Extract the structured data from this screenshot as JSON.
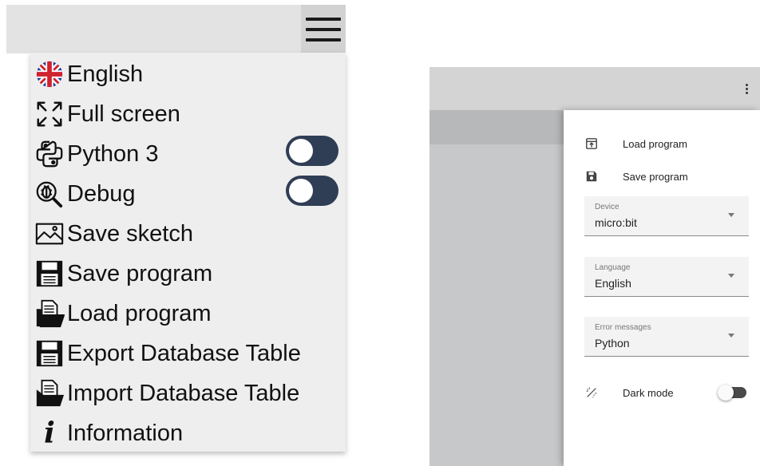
{
  "left_menu": {
    "items": [
      {
        "label": "English",
        "icon": "uk-flag-icon"
      },
      {
        "label": "Full screen",
        "icon": "fullscreen-icon"
      },
      {
        "label": "Python 3",
        "icon": "python-icon"
      },
      {
        "label": "Debug",
        "icon": "bug-icon"
      },
      {
        "label": "Save sketch",
        "icon": "image-icon"
      },
      {
        "label": "Save program",
        "icon": "floppy-disk-icon"
      },
      {
        "label": "Load program",
        "icon": "open-folder-icon"
      },
      {
        "label": "Export Database Table",
        "icon": "floppy-disk-icon"
      },
      {
        "label": "Import Database Table",
        "icon": "open-folder-icon"
      },
      {
        "label": "Information",
        "icon": "info-icon"
      }
    ],
    "toggles": {
      "python3": false,
      "debug": false
    }
  },
  "right_drawer": {
    "load_program": "Load program",
    "save_program": "Save program",
    "device": {
      "label": "Device",
      "value": "micro:bit"
    },
    "language": {
      "label": "Language",
      "value": "English"
    },
    "error_messages": {
      "label": "Error messages",
      "value": "Python"
    },
    "dark_mode": {
      "label": "Dark mode",
      "enabled": false
    }
  },
  "colors": {
    "toggle_dark": "#2f3e55",
    "menu_bg": "#eeeeee",
    "drawer_bg": "#ffffff"
  }
}
